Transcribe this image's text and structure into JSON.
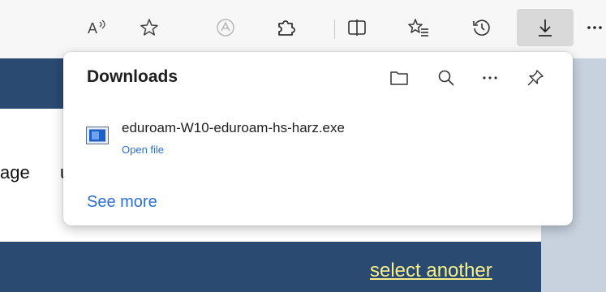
{
  "toolbar": {
    "buttons": [
      {
        "name": "read-aloud",
        "icon": "read-aloud-icon"
      },
      {
        "name": "favorite-star",
        "icon": "star-icon"
      },
      {
        "name": "extension-disabled",
        "icon": "extension-faded-icon"
      },
      {
        "name": "extensions",
        "icon": "puzzle-icon"
      },
      {
        "name": "split-screen",
        "icon": "split-screen-icon"
      },
      {
        "name": "favorites",
        "icon": "favorites-list-icon"
      },
      {
        "name": "history",
        "icon": "history-icon"
      },
      {
        "name": "downloads",
        "icon": "download-icon",
        "active": true
      },
      {
        "name": "more",
        "icon": "more-icon"
      }
    ]
  },
  "downloads_panel": {
    "title": "Downloads",
    "items": [
      {
        "file_name": "eduroam-W10-eduroam-hs-harz.exe",
        "action": "Open file",
        "icon": "executable-file-icon"
      }
    ],
    "see_more": "See more",
    "header_icons": [
      "folder-icon",
      "search-icon",
      "more-options-icon",
      "pin-icon"
    ]
  },
  "page": {
    "fragment_text": "age",
    "fragment_text_2": "u",
    "link_text": "select another"
  },
  "colors": {
    "toolbar_bg": "#f7f7f7",
    "page_blue": "#2a4a72",
    "link_blue": "#2b6fd1",
    "link_yellow": "#f6f08a"
  }
}
